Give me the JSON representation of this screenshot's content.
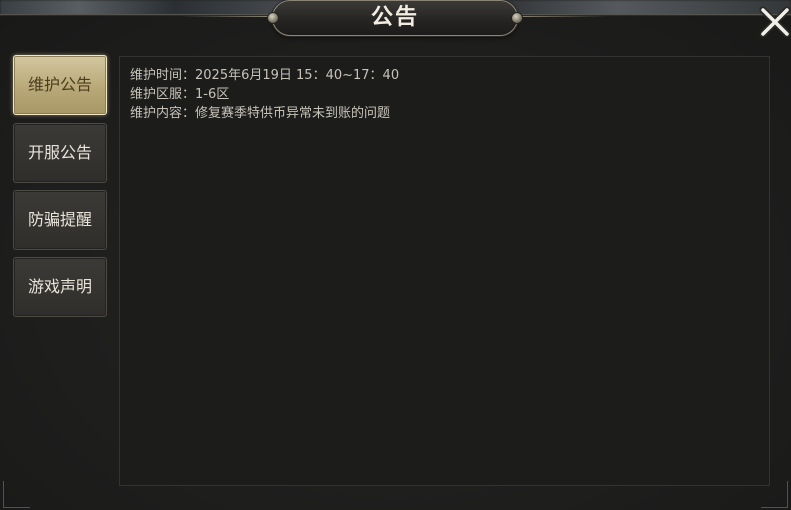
{
  "dialog": {
    "title": "公告",
    "close_icon": "close-x-icon"
  },
  "tabs": [
    {
      "label": "维护公告",
      "active": true
    },
    {
      "label": "开服公告",
      "active": false
    },
    {
      "label": "防骗提醒",
      "active": false
    },
    {
      "label": "游戏声明",
      "active": false
    }
  ],
  "content": {
    "lines": [
      "维护时间：2025年6月19日 15：40~17：40",
      "维护区服：1-6区",
      "维护内容：修复赛季特供币异常未到账的问题"
    ]
  },
  "colors": {
    "panel_bg": "#1d1d1c",
    "tab_active": "#c4b587",
    "tab_inactive": "#363431",
    "text": "#c7c3b9"
  }
}
